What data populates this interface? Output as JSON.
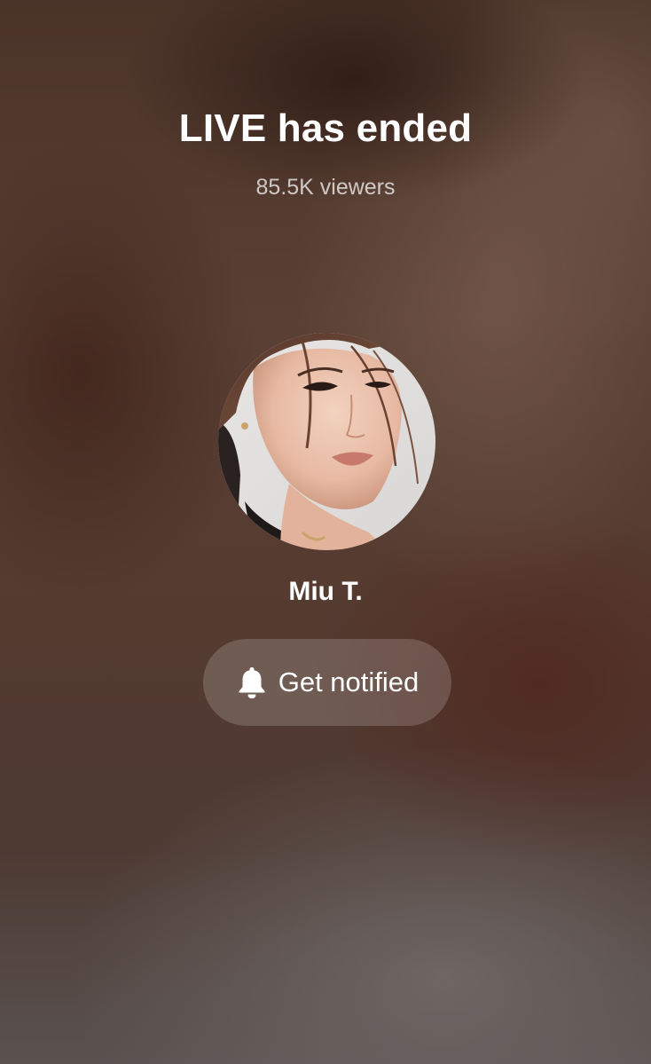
{
  "live_status": {
    "title": "LIVE has ended",
    "viewers": "85.5K viewers"
  },
  "host": {
    "name": "Miu T.",
    "avatar_icon": "profile-photo"
  },
  "notify_button": {
    "label": "Get notified",
    "icon": "bell-icon"
  },
  "colors": {
    "text_primary": "#ffffff",
    "background": "#553b30"
  }
}
